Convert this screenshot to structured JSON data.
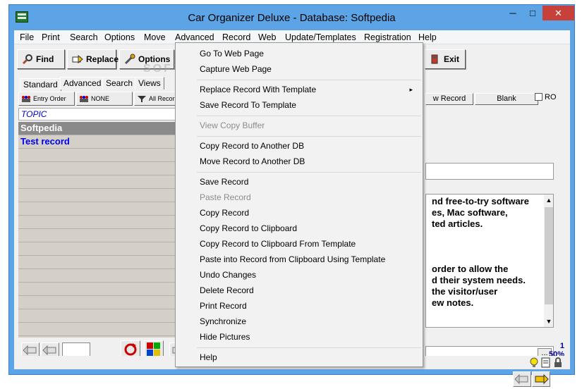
{
  "window": {
    "title": "Car Organizer Deluxe - Database: Softpedia",
    "min": "─",
    "max": "□",
    "close": "✕"
  },
  "menubar": [
    "File",
    "Print",
    "Search",
    "Options",
    "Move",
    "Advanced",
    "Record",
    "Web",
    "Update/Templates",
    "Registration",
    "Help"
  ],
  "toolbar": {
    "find": "Find",
    "replace": "Replace",
    "options": "Options",
    "exit": "Exit"
  },
  "tabs": [
    "Standard",
    "Advanced",
    "Search",
    "Views"
  ],
  "sort_buttons": {
    "entry_order": "Entry Order",
    "none": "NONE",
    "all_records": "All Recor"
  },
  "list": {
    "header": "TOPIC",
    "rows": [
      "Softpedia",
      "Test record"
    ]
  },
  "right": {
    "new_record": "w Record",
    "blank": "Blank",
    "ro_label": "RO",
    "text_lines": [
      "nd free-to-try software",
      "es, Mac software,",
      "ted articles.",
      "order to allow the",
      "d their system needs.",
      "the visitor/user",
      "ew notes."
    ],
    "dots": "...",
    "scroll_up": "▲",
    "scroll_down": "▼"
  },
  "status": {
    "count": "1",
    "zoom": "50%"
  },
  "watermark": "SOFTPEDIA",
  "context_menu": {
    "items": [
      {
        "label": "Go To Web Page",
        "enabled": true
      },
      {
        "label": "Capture Web Page",
        "enabled": true
      },
      {
        "label": "Replace Record With Template",
        "enabled": true,
        "submenu": "▸"
      },
      {
        "label": "Save Record To Template",
        "enabled": true
      },
      {
        "label": "View Copy Buffer",
        "enabled": false
      },
      {
        "label": "Copy Record to Another DB",
        "enabled": true
      },
      {
        "label": "Move Record to Another DB",
        "enabled": true
      },
      {
        "label": "Save Record",
        "enabled": true
      },
      {
        "label": "Paste Record",
        "enabled": false
      },
      {
        "label": "Copy Record",
        "enabled": true
      },
      {
        "label": "Copy Record to Clipboard",
        "enabled": true
      },
      {
        "label": "Copy Record to Clipboard From Template",
        "enabled": true
      },
      {
        "label": "Paste into Record from Clipboard Using Template",
        "enabled": true
      },
      {
        "label": "Undo Changes",
        "enabled": true
      },
      {
        "label": "Delete Record",
        "enabled": true
      },
      {
        "label": "Print Record",
        "enabled": true
      },
      {
        "label": "Synchronize",
        "enabled": true
      },
      {
        "label": "Hide Pictures",
        "enabled": true
      },
      {
        "label": "Help",
        "enabled": true
      }
    ]
  },
  "colors": {
    "titlebar": "#5da4e6",
    "close_button": "#c7413a",
    "selected_row": "#8a8a8a",
    "link_text": "#0000ee",
    "topic_header": "#0000cc"
  }
}
